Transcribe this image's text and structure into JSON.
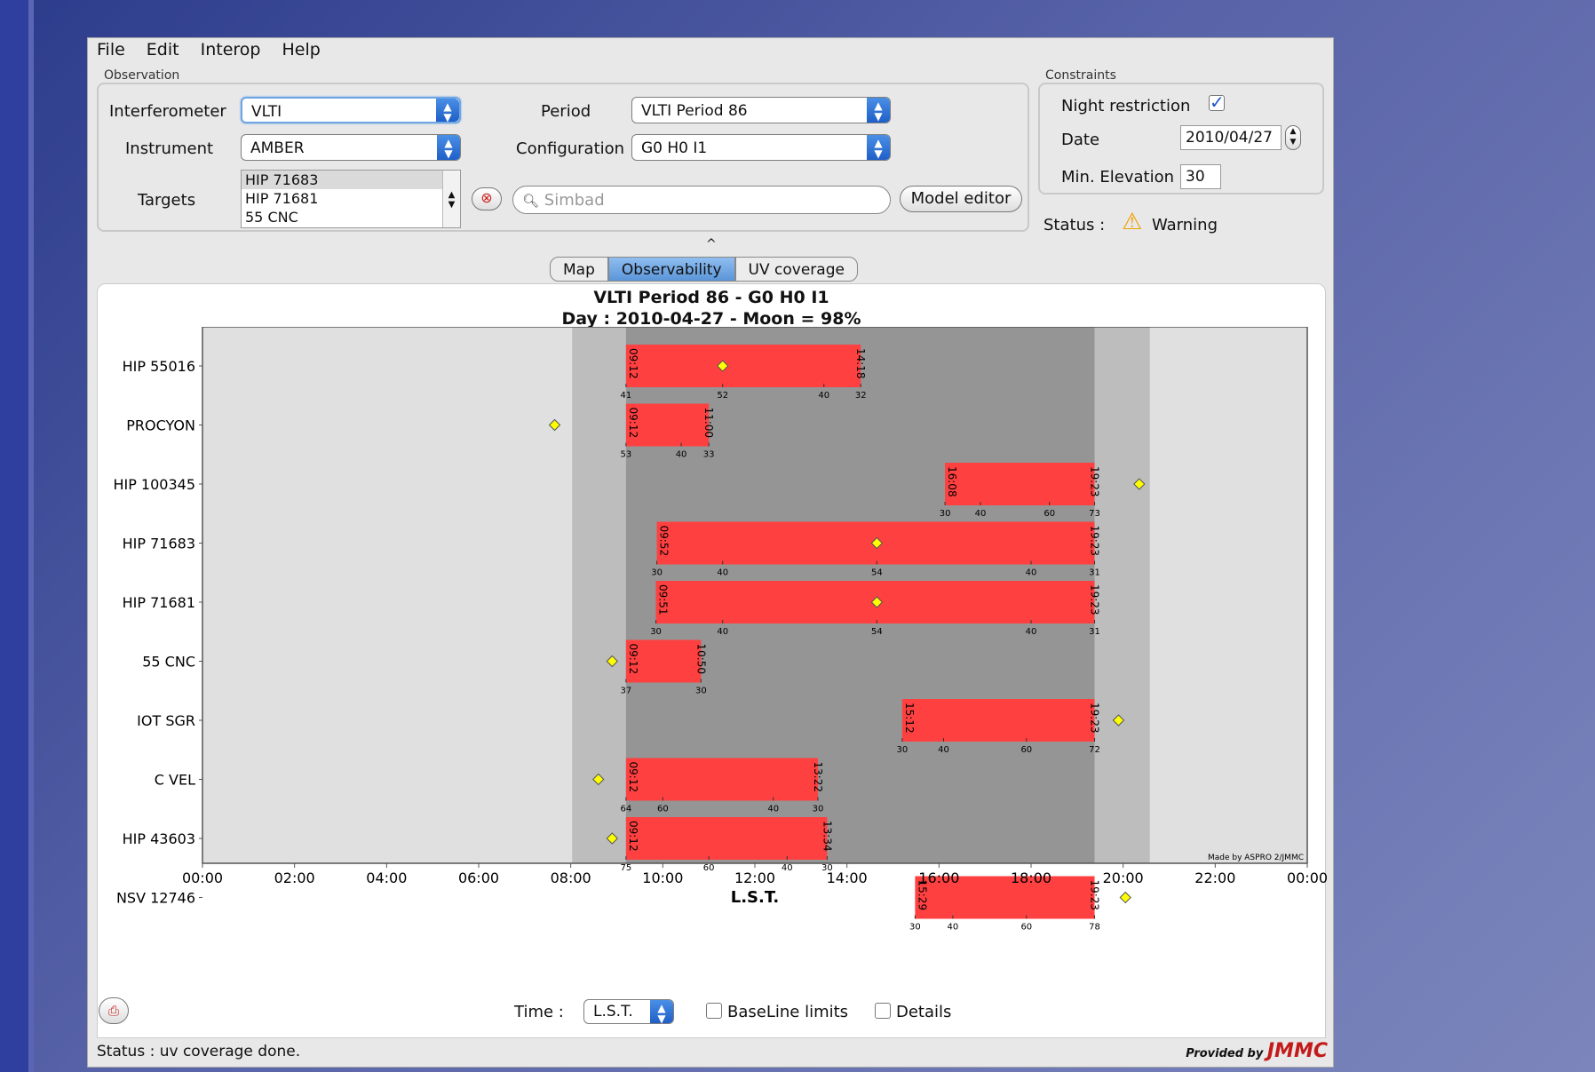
{
  "menu": [
    "File",
    "Edit",
    "Interop",
    "Help"
  ],
  "observation": {
    "group_title": "Observation",
    "interferometer_label": "Interferometer",
    "interferometer_value": "VLTI",
    "instrument_label": "Instrument",
    "instrument_value": "AMBER",
    "period_label": "Period",
    "period_value": "VLTI Period 86",
    "configuration_label": "Configuration",
    "configuration_value": "G0 H0 I1",
    "targets_label": "Targets",
    "targets": [
      "HIP 71683",
      "HIP 71681",
      "55 CNC"
    ],
    "search_placeholder": "Simbad",
    "model_editor": "Model editor"
  },
  "constraints": {
    "group_title": "Constraints",
    "night_restriction_label": "Night restriction",
    "night_restriction_checked": true,
    "date_label": "Date",
    "date_value": "2010/04/27",
    "min_elevation_label": "Min. Elevation",
    "min_elevation_value": "30",
    "status_label": "Status :",
    "status_value": "Warning"
  },
  "collapse_glyph": "^",
  "tabs": [
    "Map",
    "Observability",
    "UV coverage"
  ],
  "active_tab": "Observability",
  "chart_data": {
    "type": "gantt",
    "title": "VLTI Period 86 - G0 H0 I1",
    "subtitle": "Day : 2010-04-27 - Moon = 98%",
    "xlabel": "L.S.T.",
    "xlim": [
      0,
      24
    ],
    "x_ticks": [
      "00:00",
      "02:00",
      "04:00",
      "06:00",
      "08:00",
      "10:00",
      "12:00",
      "14:00",
      "16:00",
      "18:00",
      "20:00",
      "22:00",
      "00:00"
    ],
    "twilight_band": [
      8.03,
      20.58
    ],
    "night_band": [
      9.2,
      19.38
    ],
    "credit": "Made by ASPRO 2/JMMC",
    "targets": [
      {
        "name": "HIP 55016",
        "start": 9.2,
        "end": 14.3,
        "start_label": "09:12",
        "end_label": "14:18",
        "transit": 11.3,
        "ticks": [
          {
            "t": 9.2,
            "e": "41"
          },
          {
            "t": 11.3,
            "e": "52"
          },
          {
            "t": 13.5,
            "e": "40"
          },
          {
            "t": 14.3,
            "e": "32"
          }
        ]
      },
      {
        "name": "PROCYON",
        "start": 9.2,
        "end": 11.0,
        "start_label": "09:12",
        "end_label": "11:00",
        "transit": 7.65,
        "ticks": [
          {
            "t": 9.2,
            "e": "53"
          },
          {
            "t": 10.4,
            "e": "40"
          },
          {
            "t": 11.0,
            "e": "33"
          }
        ]
      },
      {
        "name": "HIP 100345",
        "start": 16.13,
        "end": 19.38,
        "start_label": "16:08",
        "end_label": "19:23",
        "transit": 20.35,
        "ticks": [
          {
            "t": 16.13,
            "e": "30"
          },
          {
            "t": 16.9,
            "e": "40"
          },
          {
            "t": 18.4,
            "e": "60"
          },
          {
            "t": 19.38,
            "e": "73"
          }
        ]
      },
      {
        "name": "HIP 71683",
        "start": 9.87,
        "end": 19.38,
        "start_label": "09:52",
        "end_label": "19:23",
        "transit": 14.65,
        "ticks": [
          {
            "t": 9.87,
            "e": "30"
          },
          {
            "t": 11.3,
            "e": "40"
          },
          {
            "t": 14.65,
            "e": "54"
          },
          {
            "t": 18.0,
            "e": "40"
          },
          {
            "t": 19.38,
            "e": "31"
          }
        ]
      },
      {
        "name": "HIP 71681",
        "start": 9.85,
        "end": 19.38,
        "start_label": "09:51",
        "end_label": "19:23",
        "transit": 14.65,
        "ticks": [
          {
            "t": 9.85,
            "e": "30"
          },
          {
            "t": 11.3,
            "e": "40"
          },
          {
            "t": 14.65,
            "e": "54"
          },
          {
            "t": 18.0,
            "e": "40"
          },
          {
            "t": 19.38,
            "e": "31"
          }
        ]
      },
      {
        "name": "55 CNC",
        "start": 9.2,
        "end": 10.83,
        "start_label": "09:12",
        "end_label": "10:50",
        "transit": 8.9,
        "ticks": [
          {
            "t": 9.2,
            "e": "37"
          },
          {
            "t": 10.83,
            "e": "30"
          }
        ]
      },
      {
        "name": "IOT SGR",
        "start": 15.2,
        "end": 19.38,
        "start_label": "15:12",
        "end_label": "19:23",
        "transit": 19.9,
        "ticks": [
          {
            "t": 15.2,
            "e": "30"
          },
          {
            "t": 16.1,
            "e": "40"
          },
          {
            "t": 17.9,
            "e": "60"
          },
          {
            "t": 19.38,
            "e": "72"
          }
        ]
      },
      {
        "name": "C VEL",
        "start": 9.2,
        "end": 13.37,
        "start_label": "09:12",
        "end_label": "13:22",
        "transit": 8.6,
        "ticks": [
          {
            "t": 9.2,
            "e": "64"
          },
          {
            "t": 10.0,
            "e": "60"
          },
          {
            "t": 12.4,
            "e": "40"
          },
          {
            "t": 13.37,
            "e": "30"
          }
        ]
      },
      {
        "name": "HIP 43603",
        "start": 9.2,
        "end": 13.57,
        "start_label": "09:12",
        "end_label": "13:34",
        "transit": 8.9,
        "ticks": [
          {
            "t": 9.2,
            "e": "75"
          },
          {
            "t": 11.0,
            "e": "60"
          },
          {
            "t": 12.7,
            "e": "40"
          },
          {
            "t": 13.57,
            "e": "30"
          }
        ]
      },
      {
        "name": "NSV 12746",
        "start": 15.48,
        "end": 19.38,
        "start_label": "15:29",
        "end_label": "19:23",
        "transit": 20.05,
        "ticks": [
          {
            "t": 15.48,
            "e": "30"
          },
          {
            "t": 16.3,
            "e": "40"
          },
          {
            "t": 17.9,
            "e": "60"
          },
          {
            "t": 19.38,
            "e": "78"
          }
        ]
      }
    ],
    "colors": {
      "bar": "#ff4040",
      "twilight": "#bdbdbd",
      "night": "#959595",
      "plot_bg": "#e0e0e0",
      "transit": "#ffff00"
    }
  },
  "bottom": {
    "time_label": "Time :",
    "time_value": "L.S.T.",
    "baseline_label": "BaseLine limits",
    "details_label": "Details"
  },
  "statusbar": {
    "text": "Status :  uv coverage done.",
    "provided_by": "Provided by",
    "logo": "JMMC"
  }
}
